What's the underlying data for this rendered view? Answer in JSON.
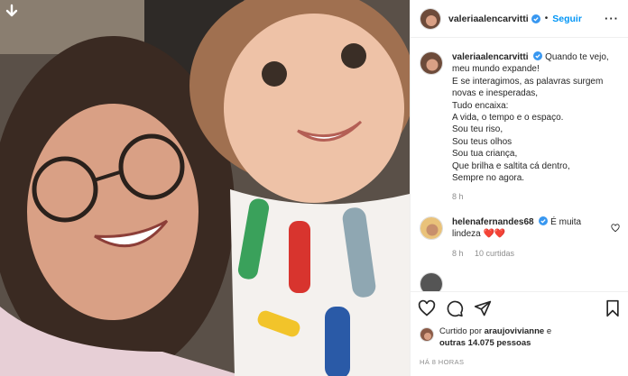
{
  "post": {
    "photo_alt": "",
    "author": {
      "username": "valeriaalencarvitti",
      "verified": true
    },
    "follow_label": "Seguir",
    "caption_lines": [
      "Quando te vejo,",
      "meu mundo expande!",
      "E se interagimos, as palavras surgem",
      "novas e inesperadas,",
      "Tudo encaixa:",
      "A vida, o tempo e o espaço.",
      "Sou teu riso,",
      "Sou teus olhos",
      "Sou tua criança,",
      "Que brilha e saltita cá dentro,",
      "Sempre no agora."
    ],
    "caption_time": "8 h",
    "comments": [
      {
        "username": "helenafernandes68",
        "verified": true,
        "text_start": "É muita",
        "text_end": "lindeza",
        "emoji": "❤️❤️",
        "time": "8 h",
        "likes": "10 curtidas"
      }
    ],
    "liked_by": {
      "prefix": "Curtido por",
      "first_user": "araujovivianne",
      "connector": "e",
      "others": "outras 14.075 pessoas"
    },
    "timestamp": "HÁ 8 HORAS"
  },
  "icons": {
    "download": "download-arrow-icon",
    "more": "more-options-icon",
    "like": "heart-icon",
    "comment": "comment-bubble-icon",
    "share": "paper-plane-icon",
    "save": "bookmark-icon"
  },
  "colors": {
    "link_blue": "#0095f6",
    "verified_blue": "#3897f0",
    "heart_red": "#e0103a",
    "muted_gray": "#8e8e8e"
  }
}
